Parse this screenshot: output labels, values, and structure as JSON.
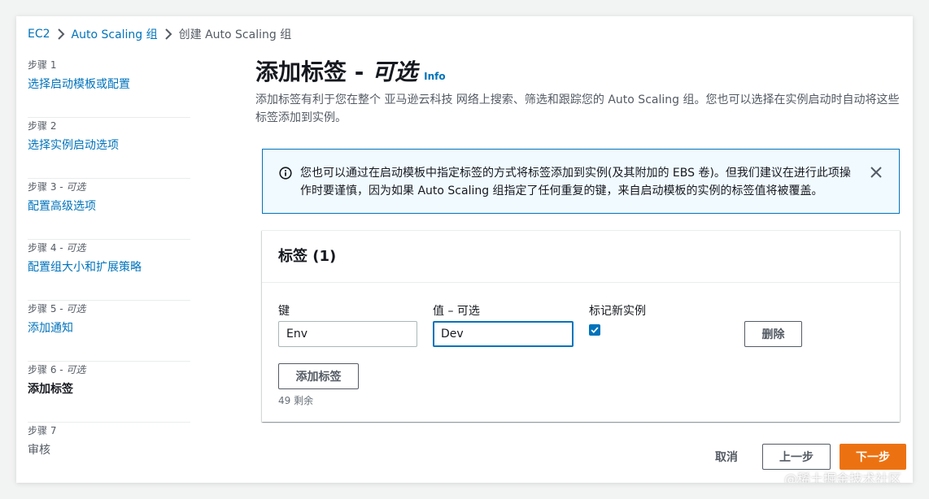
{
  "breadcrumb": {
    "items": [
      "EC2",
      "Auto Scaling 组",
      "创建 Auto Scaling 组"
    ]
  },
  "sidebar": {
    "steps": [
      {
        "label": "步骤 1",
        "optional": "",
        "title": "选择启动模板或配置",
        "state": "link"
      },
      {
        "label": "步骤 2",
        "optional": "",
        "title": "选择实例启动选项",
        "state": "link"
      },
      {
        "label": "步骤 3 - ",
        "optional": "可选",
        "title": "配置高级选项",
        "state": "link"
      },
      {
        "label": "步骤 4 - ",
        "optional": "可选",
        "title": "配置组大小和扩展策略",
        "state": "link"
      },
      {
        "label": "步骤 5 - ",
        "optional": "可选",
        "title": "添加通知",
        "state": "link"
      },
      {
        "label": "步骤 6 - ",
        "optional": "可选",
        "title": "添加标签",
        "state": "current"
      },
      {
        "label": "步骤 7",
        "optional": "",
        "title": "审核",
        "state": "disabled"
      }
    ]
  },
  "main": {
    "title": "添加标签 - ",
    "title_optional": "可选",
    "info": "Info",
    "description": "添加标签有利于您在整个 亚马逊云科技 网络上搜索、筛选和跟踪您的 Auto Scaling 组。您也可以选择在实例启动时自动将这些标签添加到实例。"
  },
  "alert": {
    "text": "您也可以通过在启动模板中指定标签的方式将标签添加到实例(及其附加的 EBS 卷)。但我们建议在进行此项操作时要谨慎，因为如果 Auto Scaling 组指定了任何重复的键，来自启动模板的实例的标签值将被覆盖。"
  },
  "tags_panel": {
    "header": "标签 (1)",
    "key_label": "键",
    "value_label": "值 – 可选",
    "tag_new_label": "标记新实例",
    "key_value": "Env",
    "value_value": "Dev",
    "tag_new_checked": true,
    "remove_label": "删除",
    "add_label": "添加标签",
    "remaining": "49 剩余"
  },
  "footer": {
    "cancel": "取消",
    "previous": "上一步",
    "next": "下一步"
  },
  "watermark": "@稀土掘金技术社区",
  "colors": {
    "link": "#0073bb",
    "primary": "#ec7211",
    "alert_bg": "#f1faff",
    "text": "#16191f",
    "secondary_text": "#545b64"
  }
}
